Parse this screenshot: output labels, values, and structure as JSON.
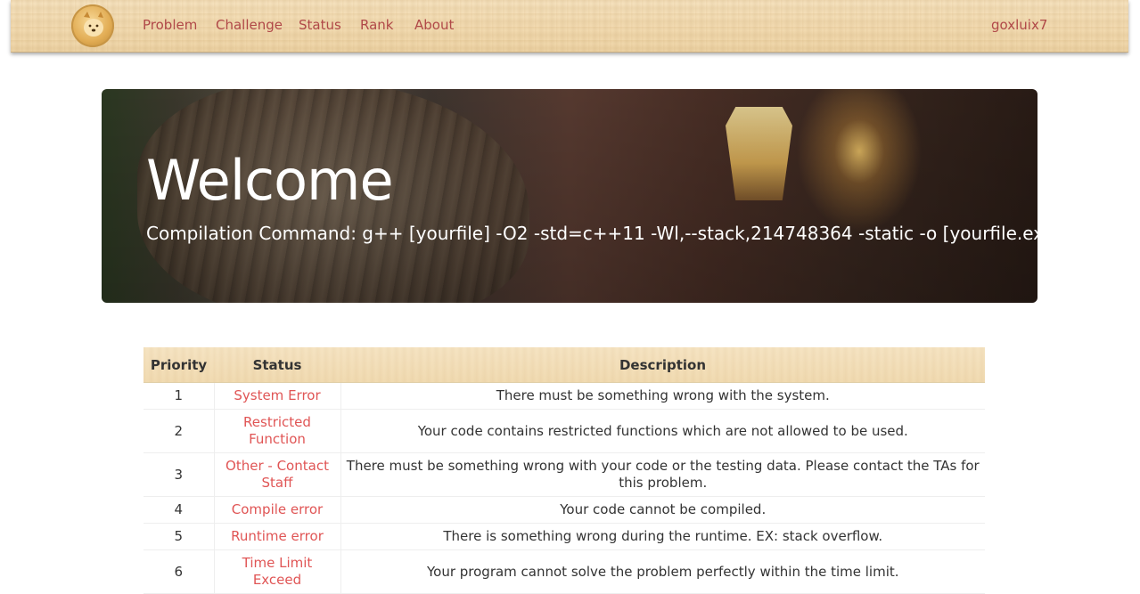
{
  "navbar": {
    "logo_icon": "dog-logo-icon",
    "links": [
      "Problem",
      "Challenge",
      "Status",
      "Rank",
      "About"
    ],
    "username": "goxluix7"
  },
  "hero": {
    "title": "Welcome",
    "subtitle": "Compilation Command: g++ [yourfile] -O2 -std=c++11 -Wl,--stack,214748364 -static -o [yourfile.exe]"
  },
  "table": {
    "headers": [
      "Priority",
      "Status",
      "Description"
    ],
    "rows": [
      {
        "priority": "1",
        "status": "System Error",
        "description": "There must be something wrong with the system."
      },
      {
        "priority": "2",
        "status": "Restricted Function",
        "description": "Your code contains restricted functions which are not allowed to be used."
      },
      {
        "priority": "3",
        "status": "Other - Contact Staff",
        "description": "There must be something wrong with your code or the testing data. Please contact the TAs for this problem."
      },
      {
        "priority": "4",
        "status": "Compile error",
        "description": "Your code cannot be compiled."
      },
      {
        "priority": "5",
        "status": "Runtime error",
        "description": "There is something wrong during the runtime. EX: stack overflow."
      },
      {
        "priority": "6",
        "status": "Time Limit Exceed",
        "description": "Your program cannot solve the problem perfectly within the time limit."
      }
    ]
  },
  "colors": {
    "link": "#b04848",
    "status_link": "#e05555",
    "text": "#333333"
  }
}
